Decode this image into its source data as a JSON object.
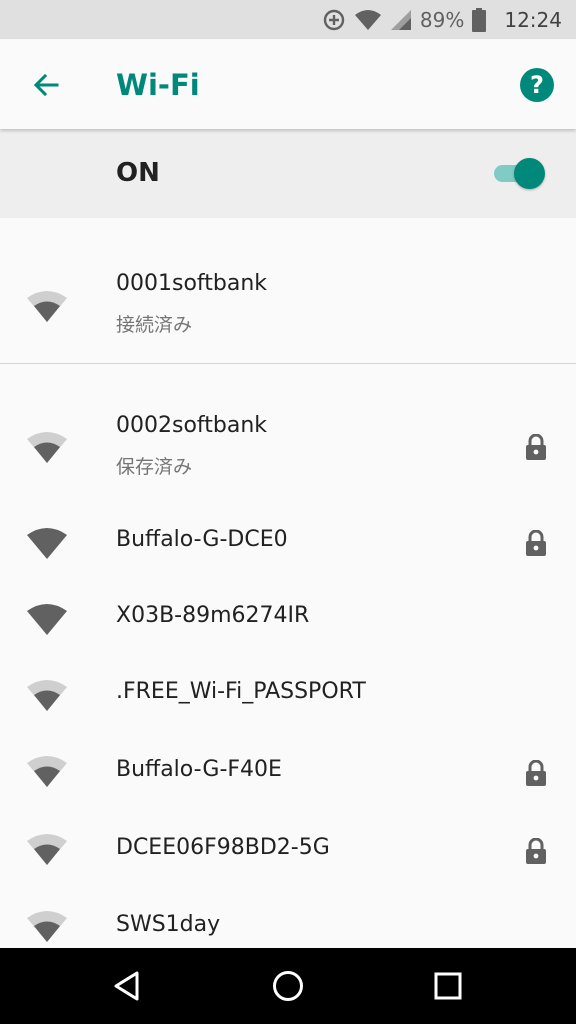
{
  "status_bar": {
    "icons": [
      "data-saver-icon",
      "wifi-signal-icon",
      "cell-signal-icon",
      "battery-icon"
    ],
    "battery": "89%",
    "time": "12:24"
  },
  "app_bar": {
    "title": "Wi-Fi",
    "back_icon": "arrow-back-icon",
    "help_icon": "help-icon",
    "help_glyph": "?"
  },
  "master_switch": {
    "label": "ON",
    "enabled": true
  },
  "connected_network": {
    "ssid": "0001softbank",
    "status": "接続済み",
    "signal": "strong-light"
  },
  "networks": [
    {
      "ssid": "0002softbank",
      "status": "保存済み",
      "secured": true,
      "signal": "light"
    },
    {
      "ssid": "Buffalo-G-DCE0",
      "status": "",
      "secured": true,
      "signal": "full"
    },
    {
      "ssid": "X03B-89m6274IR",
      "status": "",
      "secured": false,
      "signal": "full"
    },
    {
      "ssid": ".FREE_Wi-Fi_PASSPORT",
      "status": "",
      "secured": false,
      "signal": "light"
    },
    {
      "ssid": "Buffalo-G-F40E",
      "status": "",
      "secured": true,
      "signal": "light"
    },
    {
      "ssid": "DCEE06F98BD2-5G",
      "status": "",
      "secured": true,
      "signal": "light"
    },
    {
      "ssid": "SWS1day",
      "status": "",
      "secured": false,
      "signal": "light"
    }
  ],
  "nav_bar": {
    "buttons": [
      "back-triangle-icon",
      "home-circle-icon",
      "recents-square-icon"
    ]
  },
  "colors": {
    "accent": "#00897b",
    "accent_light": "#80cbc4",
    "icon_dark": "#616161",
    "icon_light": "#cfcfcf"
  }
}
